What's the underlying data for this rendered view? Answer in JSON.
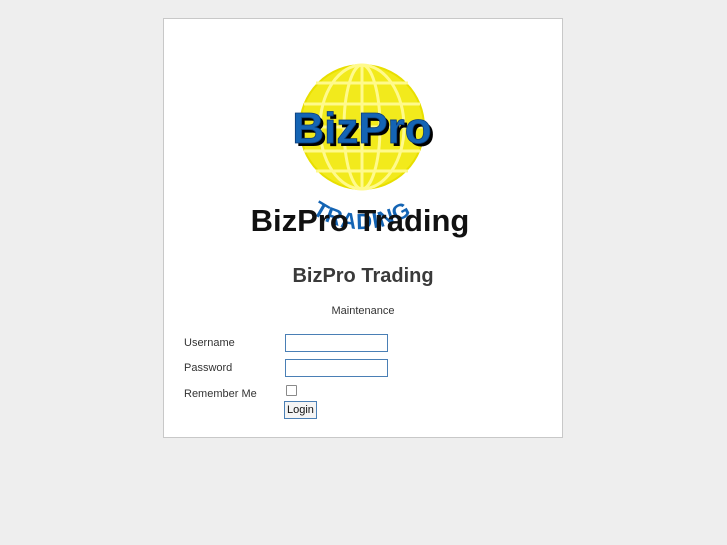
{
  "logo": {
    "top_text": "BizPro",
    "bottom_text": "TRADING",
    "caption": "BizPro Trading",
    "globe_color": "#f2ea1c",
    "globe_line_color": "#ffff66",
    "text_blue": "#1464b4"
  },
  "header": {
    "title": "BizPro Trading",
    "subtitle": "Maintenance"
  },
  "form": {
    "username_label": "Username",
    "username_value": "",
    "password_label": "Password",
    "password_value": "",
    "remember_label": "Remember Me",
    "remember_checked": false,
    "login_label": "Login"
  }
}
